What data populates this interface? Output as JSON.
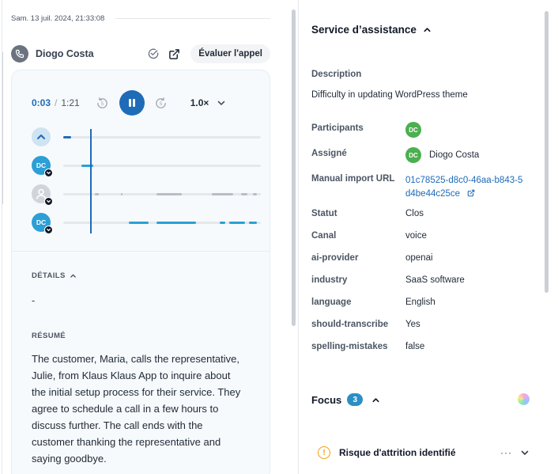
{
  "call": {
    "timestamp": "Sam. 13 juil. 2024, 21:33:08",
    "caller_name": "Diogo Costa",
    "evaluate_label": "Évaluer l'appel"
  },
  "player": {
    "current_time": "0:03",
    "separator": "/",
    "total_time": "1:21",
    "speed": "1.0×",
    "progress_fraction": 0.037
  },
  "tracks": [
    {
      "avatar": "chevron-up",
      "initials": "",
      "segments": [
        [
          0.0,
          0.04
        ]
      ],
      "color": "#1e6bb8"
    },
    {
      "avatar": "dc",
      "initials": "DC",
      "segments": [
        [
          0.09,
          0.15
        ]
      ],
      "color": "#2b9fd6"
    },
    {
      "avatar": "person",
      "initials": "",
      "segments": [
        [
          0.16,
          0.18
        ],
        [
          0.29,
          0.3
        ],
        [
          0.47,
          0.6
        ],
        [
          0.75,
          0.86
        ],
        [
          0.9,
          0.93
        ],
        [
          0.96,
          0.98
        ]
      ],
      "color": "#b8bec6"
    },
    {
      "avatar": "dc",
      "initials": "DC",
      "segments": [
        [
          0.33,
          0.43
        ],
        [
          0.47,
          0.67
        ],
        [
          0.79,
          0.82
        ],
        [
          0.84,
          0.92
        ],
        [
          0.94,
          0.98
        ]
      ],
      "color": "#2b9fd6"
    }
  ],
  "details": {
    "title": "DÉTAILS",
    "value": "-"
  },
  "summary": {
    "title": "RÉSUMÉ",
    "text": "The customer, Maria, calls the representative, Julie, from Klaus Klaus App to inquire about the initial setup process for their service. They agree to schedule a call in a few hours to discuss further. The call ends with the customer thanking the representative and saying goodbye."
  },
  "panel": {
    "title": "Service d’assistance",
    "description_label": "Description",
    "description_value": "Difficulty in updating WordPress theme",
    "participants_label": "Participants",
    "participant_initials": "DC",
    "assigned_label": "Assigné",
    "assigned_initials": "DC",
    "assigned_name": "Diogo Costa",
    "import_url_label": "Manual import URL",
    "import_url_value": "01c78525-d8c0-46aa-b843-5d4be44c25ce",
    "status_label": "Statut",
    "status_value": "Clos",
    "channel_label": "Canal",
    "channel_value": "voice",
    "ai_provider_label": "ai-provider",
    "ai_provider_value": "openai",
    "industry_label": "industry",
    "industry_value": "SaaS software",
    "language_label": "language",
    "language_value": "English",
    "transcribe_label": "should-transcribe",
    "transcribe_value": "Yes",
    "spelling_label": "spelling-mistakes",
    "spelling_value": "false"
  },
  "focus": {
    "title": "Focus",
    "count": "3",
    "item_label": "Risque d'attrition identifié",
    "item_menu": "···"
  },
  "colors": {
    "accent": "#1e6bb8",
    "avatar_green": "#4caf50",
    "avatar_blue": "#2b9fd6",
    "warning": "#f59e0b"
  }
}
